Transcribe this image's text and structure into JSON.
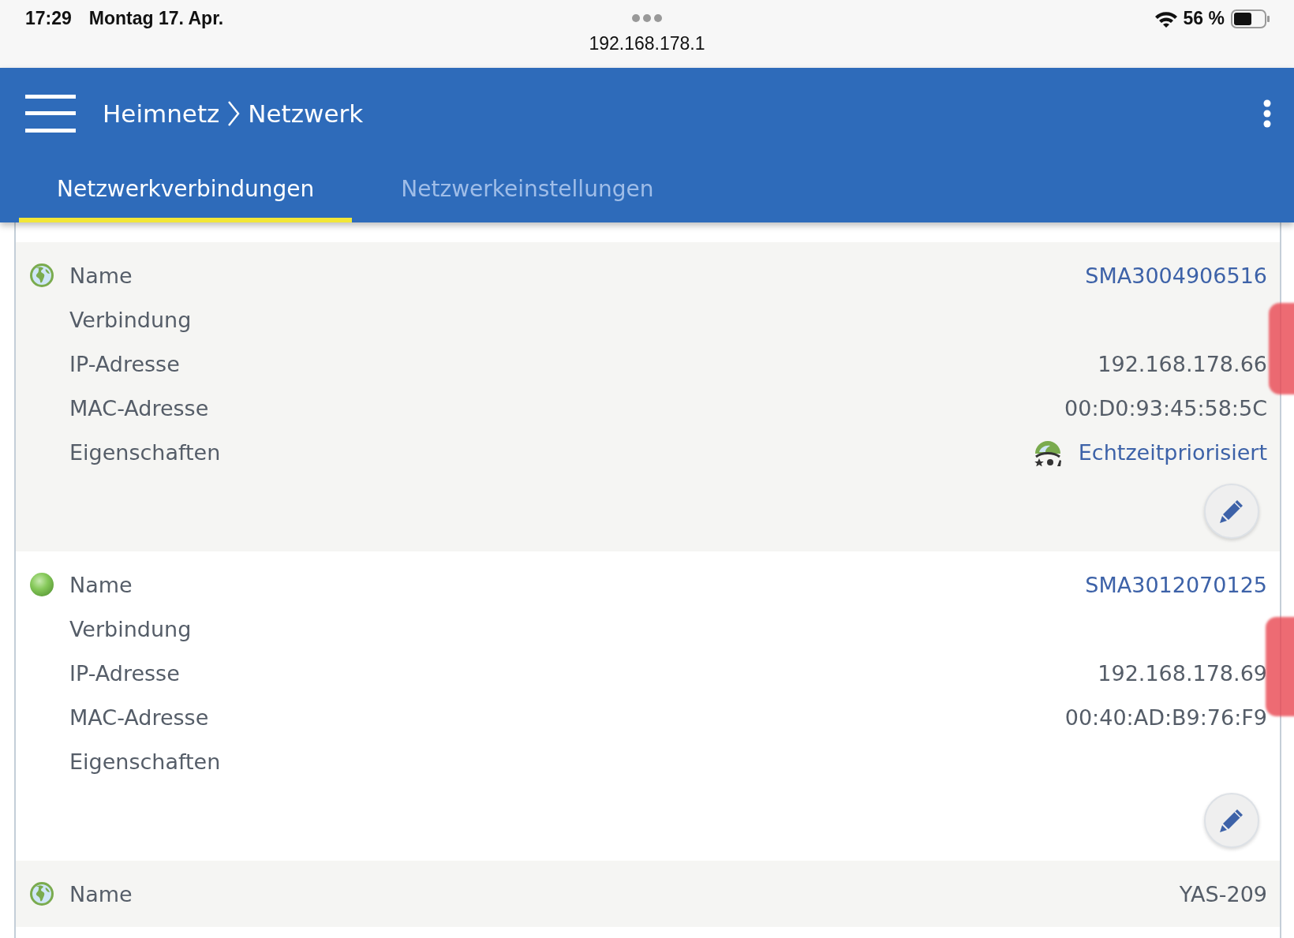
{
  "status_bar": {
    "time": "17:29",
    "date": "Montag 17. Apr.",
    "url": "192.168.178.1",
    "battery": "56 %"
  },
  "header": {
    "breadcrumb": [
      "Heimnetz",
      "Netzwerk"
    ]
  },
  "tabs": [
    {
      "label": "Netzwerkverbindungen",
      "selected": true
    },
    {
      "label": "Netzwerkeinstellungen",
      "selected": false
    }
  ],
  "devices": [
    {
      "kind": "globe",
      "rows": [
        {
          "label": "Name",
          "value": "SMA3004906516",
          "kind": "link"
        },
        {
          "label": "Verbindung"
        },
        {
          "label": "IP-Adresse",
          "value": "192.168.178.66",
          "kind": "text"
        },
        {
          "label": "MAC-Adresse",
          "value": "00:D0:93:45:58:5C",
          "kind": "text"
        },
        {
          "label": "Eigenschaften",
          "value": "Echtzeitpriorisiert",
          "kind": "badge"
        }
      ],
      "editable": true
    },
    {
      "kind": "dot",
      "rows": [
        {
          "label": "Name",
          "value": "SMA3012070125",
          "kind": "link"
        },
        {
          "label": "Verbindung"
        },
        {
          "label": "IP-Adresse",
          "value": "192.168.178.69",
          "kind": "text"
        },
        {
          "label": "MAC-Adresse",
          "value": "00:40:AD:B9:76:F9",
          "kind": "text"
        },
        {
          "label": "Eigenschaften"
        }
      ],
      "editable": true
    },
    {
      "kind": "globe",
      "rows": [
        {
          "label": "Name",
          "value": "YAS-209",
          "kind": "text"
        }
      ],
      "editable": false
    }
  ]
}
